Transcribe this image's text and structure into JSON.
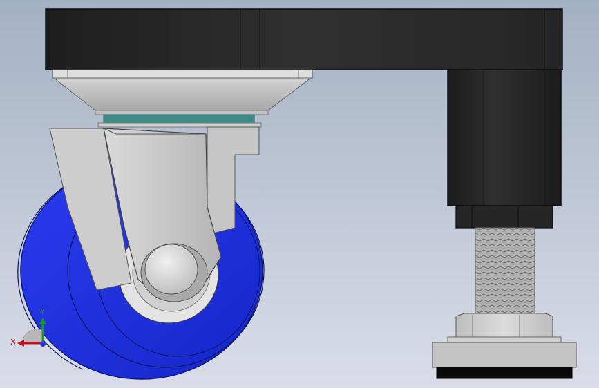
{
  "viewport": {
    "background_top": "#a3b1c4",
    "background_bottom": "#dadde8"
  },
  "colors": {
    "frame": "#2b2b2b",
    "frame_edge": "#111111",
    "steel_light": "#d6d6d6",
    "steel_mid": "#bdbdbd",
    "steel_dark": "#8e8e8e",
    "teal_ring": "#3e8a86",
    "wheel_blue": "#1f2fe0",
    "wheel_blue_dark": "#1422b5",
    "leveler_pad": "#0a0a0a",
    "axis_x": "#c0171c",
    "axis_y": "#1a9a2a",
    "axis_z": "#2840d8"
  },
  "triad": {
    "x_label": "X",
    "y_label": "Y"
  },
  "icons": {
    "orientation_triad": "xyz-triad-icon"
  }
}
